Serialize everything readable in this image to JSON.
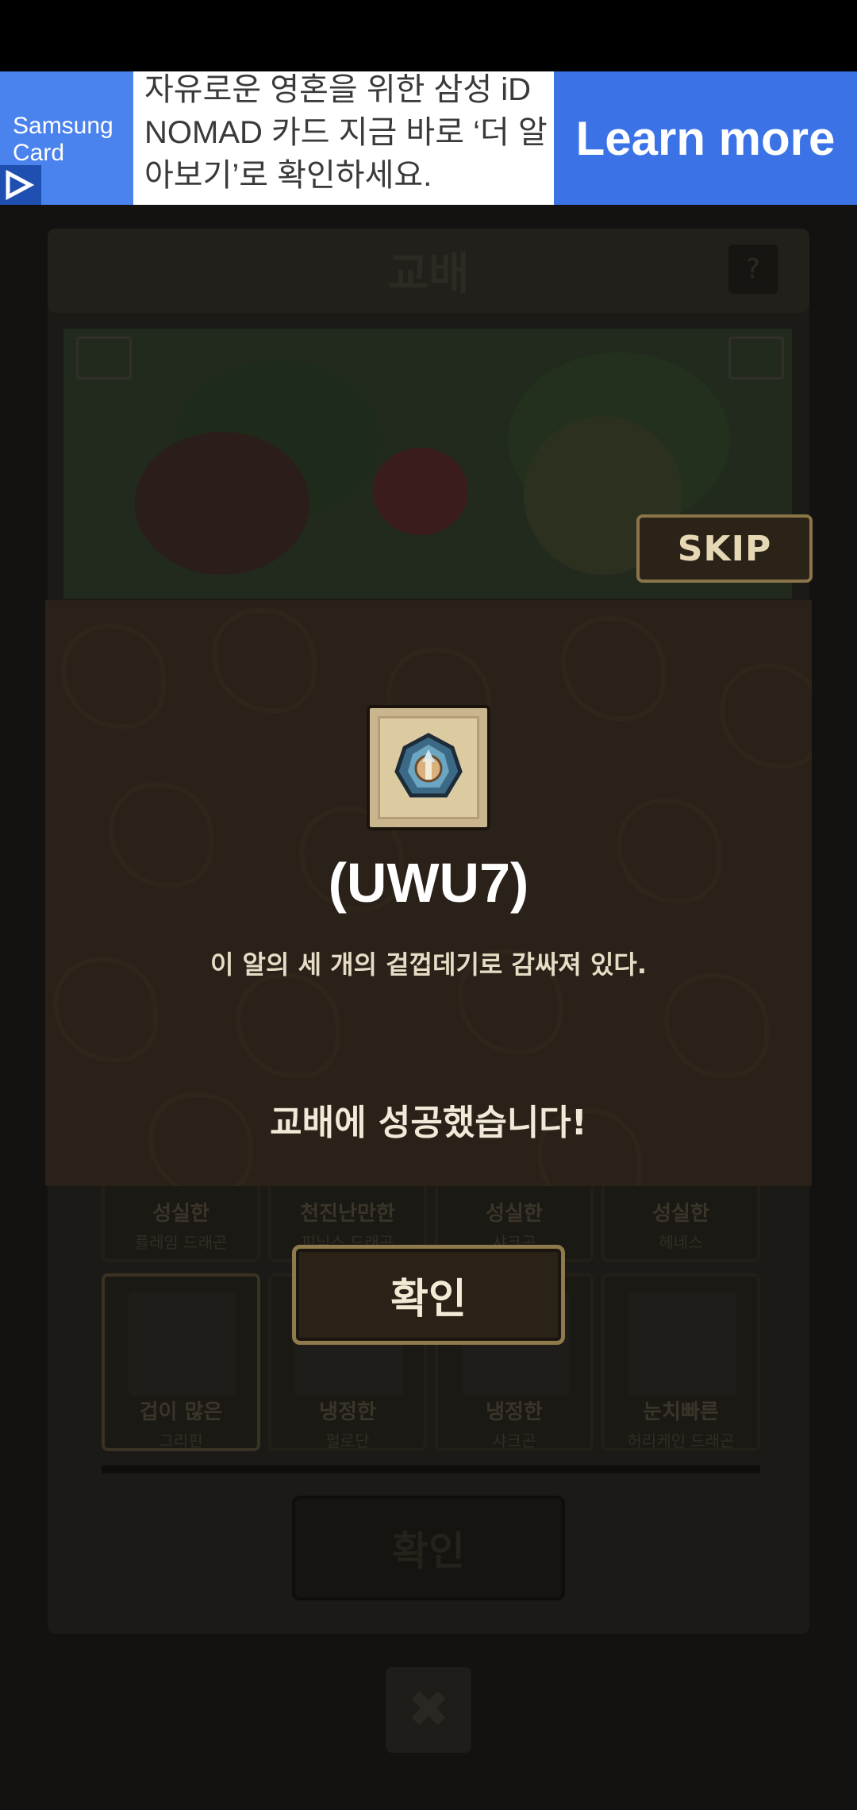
{
  "ad": {
    "brand": "Samsung Card",
    "text": "자유로운 영혼을 위한 삼성 iD NOMAD 카드 지금 바로 ‘더 알아보기’로 확인하세요.",
    "cta": "Learn more"
  },
  "background": {
    "title": "교배",
    "help_label": "?",
    "cards_row1": [
      {
        "trait": "성실한",
        "name": "플레임 드래곤"
      },
      {
        "trait": "천진난만한",
        "name": "피닉스 드래곤"
      },
      {
        "trait": "성실한",
        "name": "샤크곤"
      },
      {
        "trait": "성실한",
        "name": "헤네스"
      }
    ],
    "cards_row2": [
      {
        "trait": "겁이 많은",
        "name": "그리핀"
      },
      {
        "trait": "냉정한",
        "name": "펄로단"
      },
      {
        "trait": "냉정한",
        "name": "샤크곤"
      },
      {
        "trait": "눈치빠른",
        "name": "허리케인 드래곤"
      }
    ],
    "confirm_label": "확인",
    "close_label": "✖"
  },
  "skip_label": "SKIP",
  "modal": {
    "item_name": "(UWU7)",
    "item_description": "이 알의 세 개의 겉껍데기로 감싸져 있다.",
    "result_message": "교배에 성공했습니다!",
    "confirm_label": "확인"
  },
  "colors": {
    "ad_blue": "#3b73e6",
    "modal_bg": "#2a2219",
    "button_border": "#8f7a4c"
  }
}
